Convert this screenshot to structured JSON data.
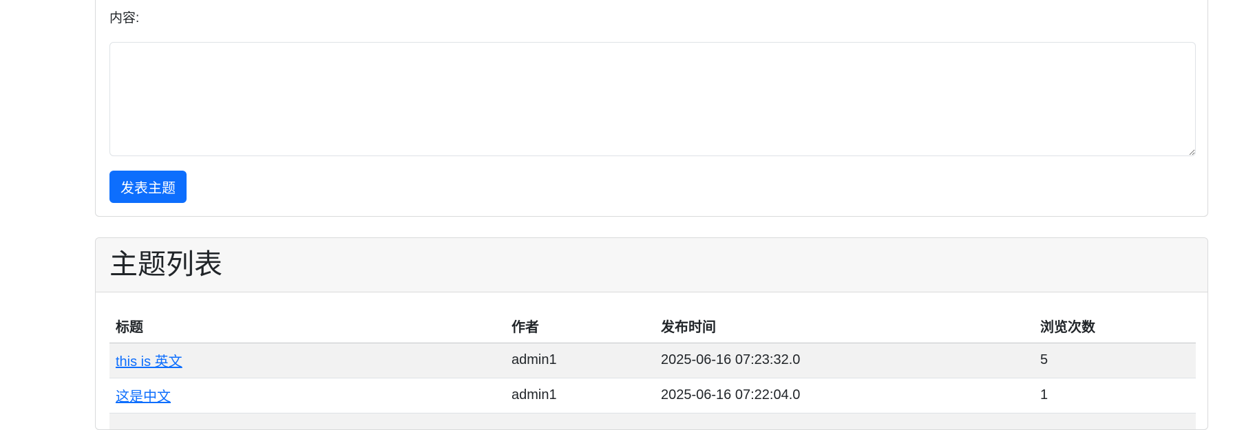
{
  "form": {
    "content_label": "内容:",
    "content_value": "",
    "submit_label": "发表主题"
  },
  "topic_list": {
    "title": "主题列表",
    "columns": [
      "标题",
      "作者",
      "发布时间",
      "浏览次数"
    ],
    "rows": [
      {
        "title": "this is 英文",
        "author": "admin1",
        "published": "2025-06-16 07:23:32.0",
        "views": "5"
      },
      {
        "title": "这是中文",
        "author": "admin1",
        "published": "2025-06-16 07:22:04.0",
        "views": "1"
      },
      {
        "title": "",
        "author": "",
        "published": "",
        "views": ""
      }
    ]
  },
  "colors": {
    "primary": "#0d6efd",
    "header_bg": "#f7f7f7",
    "stripe_bg": "#f2f2f2",
    "border": "#d9dadb"
  }
}
